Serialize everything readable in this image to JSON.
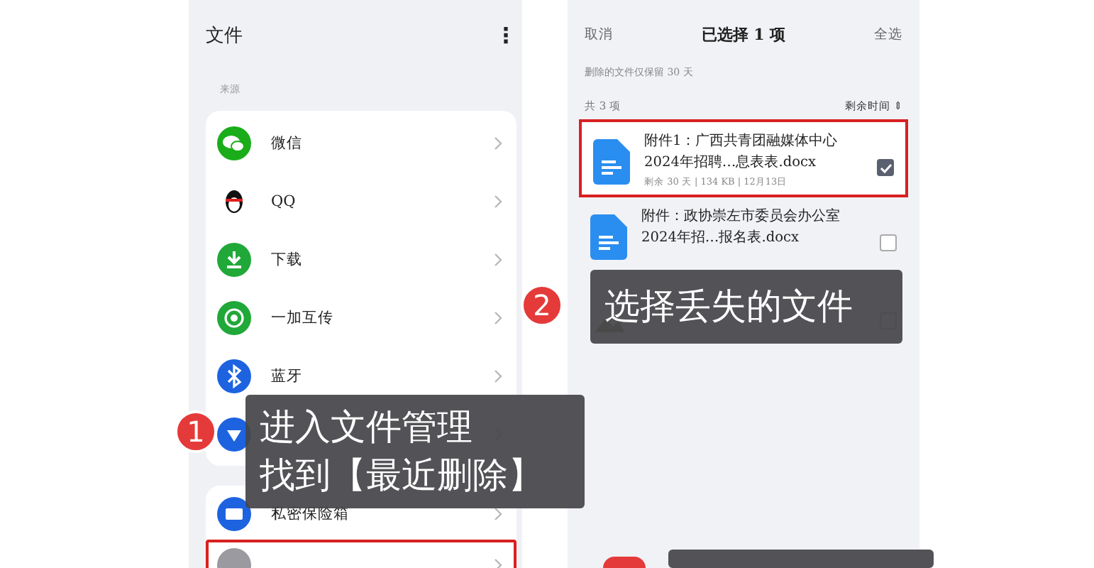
{
  "files_screen": {
    "title": "文件",
    "menu_icon": "⋮",
    "section_label": "来源",
    "sources": [
      {
        "label": "微信"
      },
      {
        "label": "QQ"
      },
      {
        "label": "下载"
      },
      {
        "label": "一加互传"
      },
      {
        "label": "蓝牙"
      }
    ],
    "private": [
      {
        "label": "私密保险箱",
        "highlighted": false
      },
      {
        "highlighted": true
      }
    ]
  },
  "recycle_screen": {
    "cancel": "取消",
    "title": "已选择 1 项",
    "select_all": "全选",
    "notice": "删除的文件仅保留 30 天",
    "count": "共 3 项",
    "sort": "剩余时间",
    "sort_icon": "⇕",
    "files": [
      {
        "name": "附件1：广西共青团融媒体中心2024年招聘…息表表.docx",
        "meta": "剩余 30 天 | 134 KB | 12月13日",
        "checked": true,
        "highlighted": true
      },
      {
        "name": "附件：政协崇左市委员会办公室2024年招…报名表.docx",
        "checked": false,
        "highlighted": false
      },
      {
        "checked": false,
        "highlighted": false
      }
    ]
  },
  "callouts": [
    {
      "kind": "full",
      "number": "1",
      "lines": [
        "进入文件管理",
        "找到【最近删除】"
      ]
    },
    {
      "kind": "full",
      "number": "2",
      "lines": [
        "选择丢失的文件"
      ]
    },
    {
      "kind": "cut"
    }
  ]
}
